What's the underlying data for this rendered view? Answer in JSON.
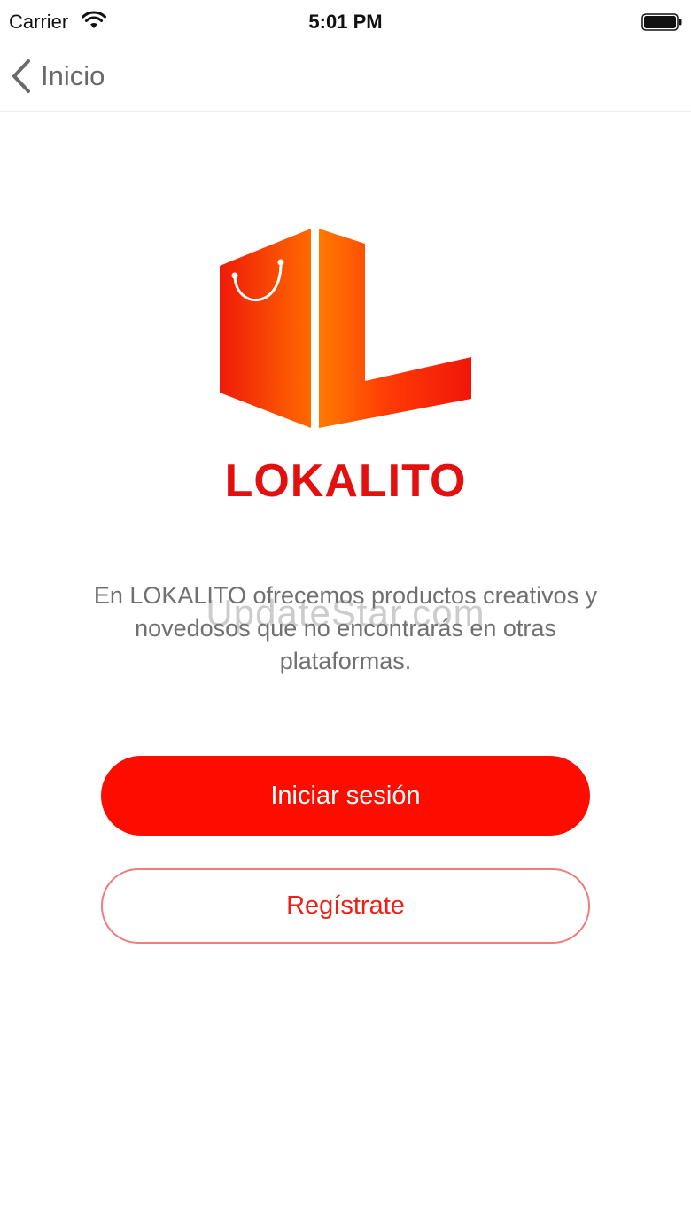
{
  "status_bar": {
    "carrier": "Carrier",
    "time": "5:01 PM",
    "wifi_icon": "wifi-icon",
    "battery_icon": "battery-icon"
  },
  "nav": {
    "back_label": "Inicio",
    "back_icon": "chevron-left-icon"
  },
  "brand": {
    "name": "LOKALITO",
    "logo_icon": "shopping-bag-l-logo-icon",
    "color": "#e31010"
  },
  "description": "En LOKALITO ofrecemos productos creativos y novedosos que no encontrarás en otras plataformas.",
  "watermark": "UpdateStar.com",
  "actions": {
    "login_label": "Iniciar sesión",
    "register_label": "Regístrate",
    "primary_color": "#fc0d00"
  }
}
